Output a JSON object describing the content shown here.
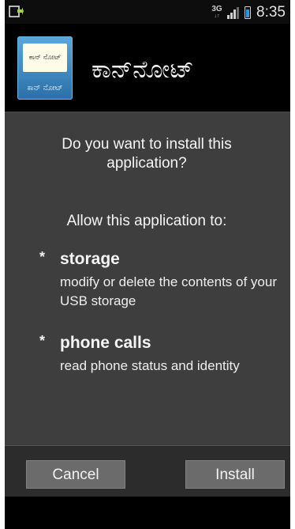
{
  "status_bar": {
    "network_type": "3G",
    "network_arrows": "↓↑",
    "time": "8:35",
    "notification_icon": "download-notification-icon",
    "battery_color": "#2c9be4"
  },
  "app": {
    "name": "ಕಾನ್‌ನೋಟ್",
    "icon_card_text": "ಕಾನ್ ನೋಟ್",
    "icon_label": "ಕಾನ್ ನೋಟ್"
  },
  "dialog": {
    "question": "Do you want to install this application?",
    "allow_heading": "Allow this application to:",
    "permissions": [
      {
        "title": "storage",
        "description": "modify or delete the contents of your USB storage"
      },
      {
        "title": "phone calls",
        "description": "read phone status and identity"
      }
    ],
    "bullet": "*"
  },
  "buttons": {
    "cancel": "Cancel",
    "install": "Install"
  }
}
